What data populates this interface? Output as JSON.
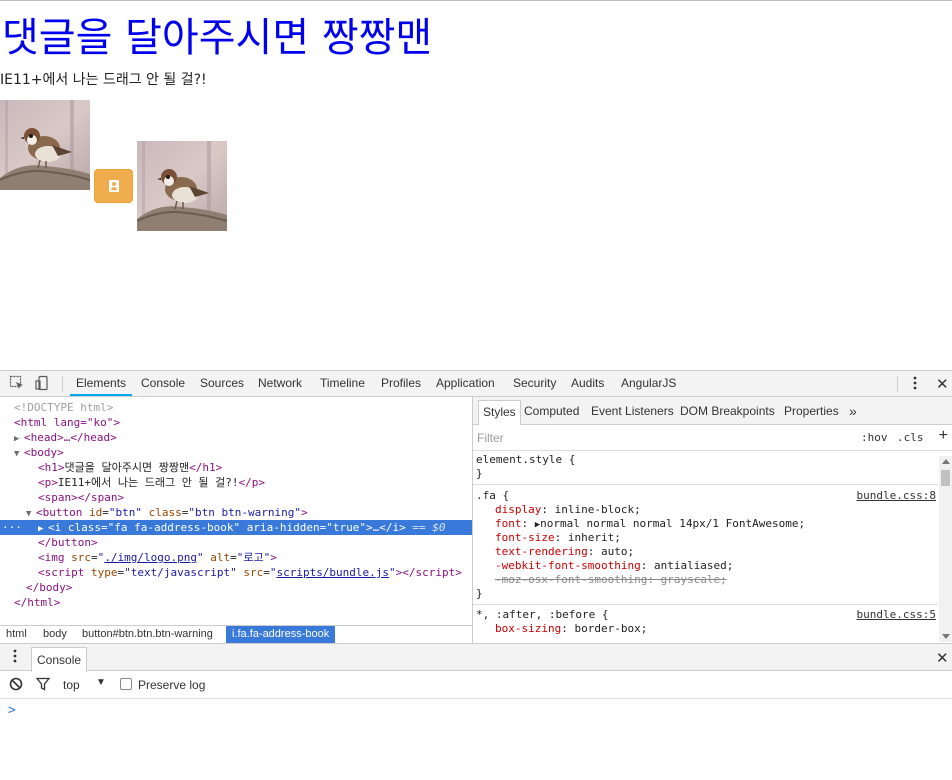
{
  "page": {
    "heading": "댓글을 달아주시면 짱짱맨",
    "paragraph": "IE11+에서 나는 드래그 안 될 걸?!",
    "image_alt": "로고",
    "button_icon": "address-book-icon",
    "colors": {
      "heading": "#0000ee",
      "button_bg": "#f0ad4e"
    }
  },
  "devtools": {
    "tabs": [
      "Elements",
      "Console",
      "Sources",
      "Network",
      "Timeline",
      "Profiles",
      "Application",
      "Security",
      "Audits",
      "AngularJS"
    ],
    "active_tab": "Elements",
    "dom": {
      "doctype": "<!DOCTYPE html>",
      "html_open": "<html lang=\"ko\">",
      "head": "<head>…</head>",
      "body_open": "<body>",
      "h1_text": "댓글을 달아주시면 짱짱맨",
      "p_text": "IE11+에서 나는 드래그 안 될 걸?!",
      "span": "<span></span>",
      "button_open_tag": "<button",
      "button_id_attr": "id",
      "button_id_val": "btn",
      "button_class_attr": "class",
      "button_class_val": "btn btn-warning",
      "i_tag": "<i",
      "i_class_attr": "class",
      "i_class_val": "fa fa-address-book",
      "i_aria_attr": "aria-hidden",
      "i_aria_val": "true",
      "i_close": ">…</i>",
      "selected_marker": "== $0",
      "button_close": "</button>",
      "img_src": "./img/logo.png",
      "img_alt": "로고",
      "script_type": "text/javascript",
      "script_src": "scripts/bundle.js",
      "body_close": "</body>",
      "html_close": "</html>"
    },
    "breadcrumbs": [
      "html",
      "body",
      "button#btn.btn.btn-warning",
      "i.fa.fa-address-book"
    ],
    "styles_tabs": [
      "Styles",
      "Computed",
      "Event Listeners",
      "DOM Breakpoints",
      "Properties"
    ],
    "filter_placeholder": "Filter",
    "hov_label": ":hov",
    "cls_label": ".cls",
    "rules": {
      "element_style": "element.style {",
      "close_brace": "}",
      "fa_selector": ".fa {",
      "fa_source": "bundle.css:8",
      "fa_props": [
        {
          "name": "display",
          "value": "inline-block;"
        },
        {
          "name": "font",
          "value": "normal normal normal 14px/1 FontAwesome;"
        },
        {
          "name": "font-size",
          "value": "inherit;"
        },
        {
          "name": "text-rendering",
          "value": "auto;"
        },
        {
          "name": "-webkit-font-smoothing",
          "value": "antialiased;"
        },
        {
          "name": "-moz-osx-font-smoothing",
          "value": "grayscale;"
        }
      ],
      "universal_selector": "*, :after, :before {",
      "universal_source": "bundle.css:5",
      "universal_props": [
        {
          "name": "box-sizing",
          "value": "border-box;"
        }
      ]
    },
    "drawer": {
      "tab": "Console",
      "context": "top",
      "preserve_log": "Preserve log",
      "prompt": ">"
    }
  }
}
